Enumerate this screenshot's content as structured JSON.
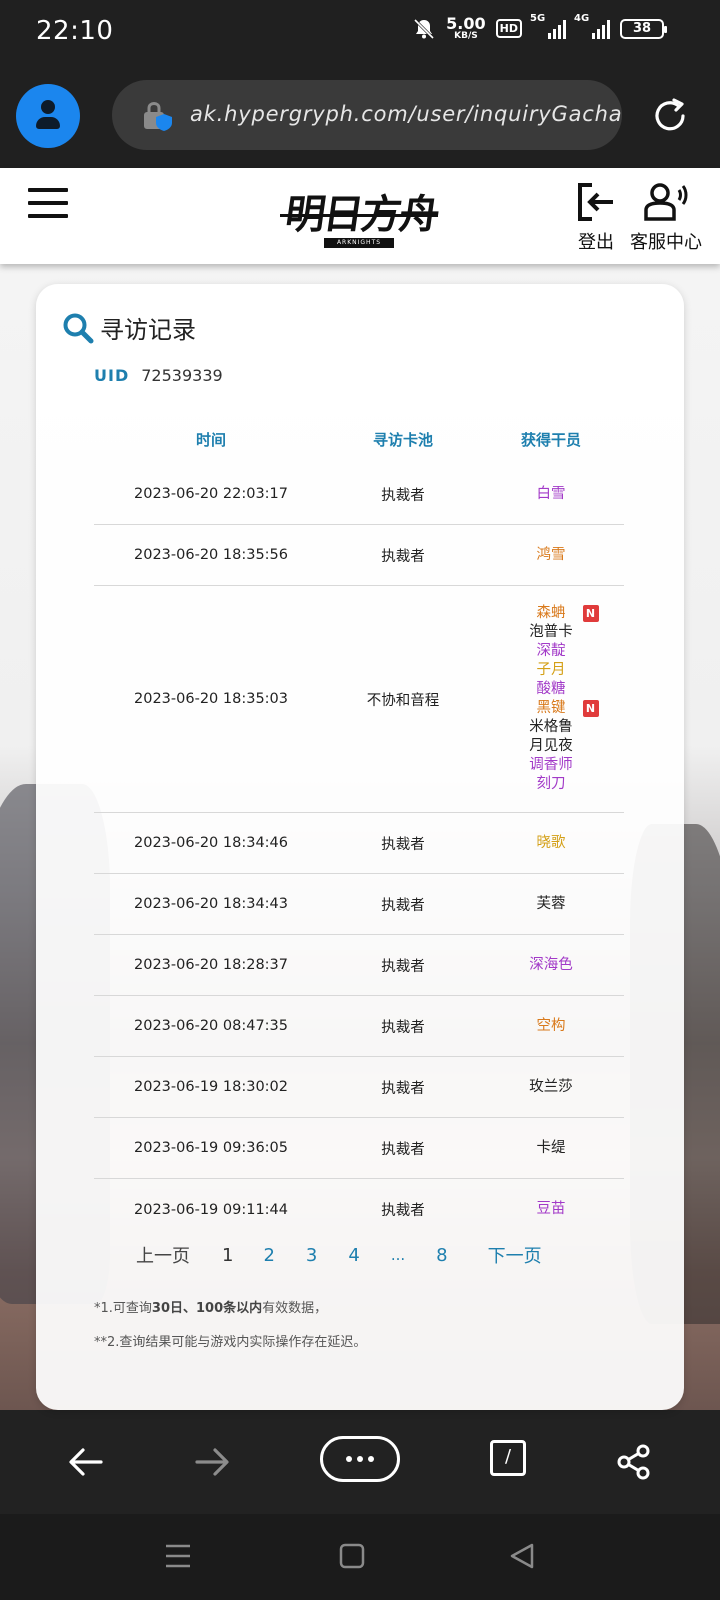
{
  "status_bar": {
    "time": "22:10",
    "speed_value": "5.00",
    "speed_unit": "KB/S",
    "hd": "HD",
    "net_5g": "5G",
    "net_4g": "4G",
    "battery": "38"
  },
  "browser": {
    "url": "ak.hypergryph.com/user/inquiryGacha"
  },
  "site_header": {
    "logo_text": "明日方舟",
    "logo_sub": "ARKNIGHTS",
    "logout_label": "登出",
    "service_label": "客服中心"
  },
  "card": {
    "title": "寻访记录",
    "uid_label": "UID",
    "uid_value": "72539339",
    "columns": [
      "时间",
      "寻访卡池",
      "获得干员"
    ],
    "rows": [
      {
        "time": "2023-06-20 22:03:17",
        "pool": "执裁者",
        "ops": [
          {
            "name": "白雪",
            "color": "#a23ac8"
          }
        ]
      },
      {
        "time": "2023-06-20 18:35:56",
        "pool": "执裁者",
        "ops": [
          {
            "name": "鸿雪",
            "color": "#d97a1c"
          }
        ]
      },
      {
        "time": "2023-06-20 18:35:03",
        "pool": "不协和音程",
        "ops": [
          {
            "name": "森蚺",
            "color": "#d97a1c",
            "badge": "N"
          },
          {
            "name": "泡普卡",
            "color": "#222222"
          },
          {
            "name": "深靛",
            "color": "#a23ac8"
          },
          {
            "name": "子月",
            "color": "#d4a017"
          },
          {
            "name": "酸糖",
            "color": "#a23ac8"
          },
          {
            "name": "黑键",
            "color": "#d97a1c",
            "badge": "N"
          },
          {
            "name": "米格鲁",
            "color": "#222222"
          },
          {
            "name": "月见夜",
            "color": "#222222"
          },
          {
            "name": "调香师",
            "color": "#a23ac8"
          },
          {
            "name": "刻刀",
            "color": "#a23ac8"
          }
        ]
      },
      {
        "time": "2023-06-20 18:34:46",
        "pool": "执裁者",
        "ops": [
          {
            "name": "晓歌",
            "color": "#d4a017"
          }
        ]
      },
      {
        "time": "2023-06-20 18:34:43",
        "pool": "执裁者",
        "ops": [
          {
            "name": "芙蓉",
            "color": "#222222"
          }
        ]
      },
      {
        "time": "2023-06-20 18:28:37",
        "pool": "执裁者",
        "ops": [
          {
            "name": "深海色",
            "color": "#a23ac8"
          }
        ]
      },
      {
        "time": "2023-06-20 08:47:35",
        "pool": "执裁者",
        "ops": [
          {
            "name": "空构",
            "color": "#d97a1c"
          }
        ]
      },
      {
        "time": "2023-06-19 18:30:02",
        "pool": "执裁者",
        "ops": [
          {
            "name": "玫兰莎",
            "color": "#222222"
          }
        ]
      },
      {
        "time": "2023-06-19 09:36:05",
        "pool": "执裁者",
        "ops": [
          {
            "name": "卡缇",
            "color": "#222222"
          }
        ]
      },
      {
        "time": "2023-06-19 09:11:44",
        "pool": "执裁者",
        "ops": [
          {
            "name": "豆苗",
            "color": "#a23ac8"
          }
        ]
      }
    ],
    "pager": {
      "prev": "上一页",
      "current": "1",
      "pages": [
        "2",
        "3",
        "4",
        "...",
        "8"
      ],
      "next": "下一页"
    },
    "note1_prefix": "*1.可查询",
    "note1_bold": "30日、100条以内",
    "note1_suffix": "有效数据，",
    "note2": "**2.查询结果可能与游戏内实际操作存在延迟。"
  },
  "bottom_nav": {
    "tabs_count": "/"
  },
  "colors": {
    "accent_blue": "#1e7fae",
    "six_star": "#d97a1c",
    "five_star": "#d4a017",
    "four_star": "#a23ac8",
    "badge_red": "#e03b3b"
  }
}
